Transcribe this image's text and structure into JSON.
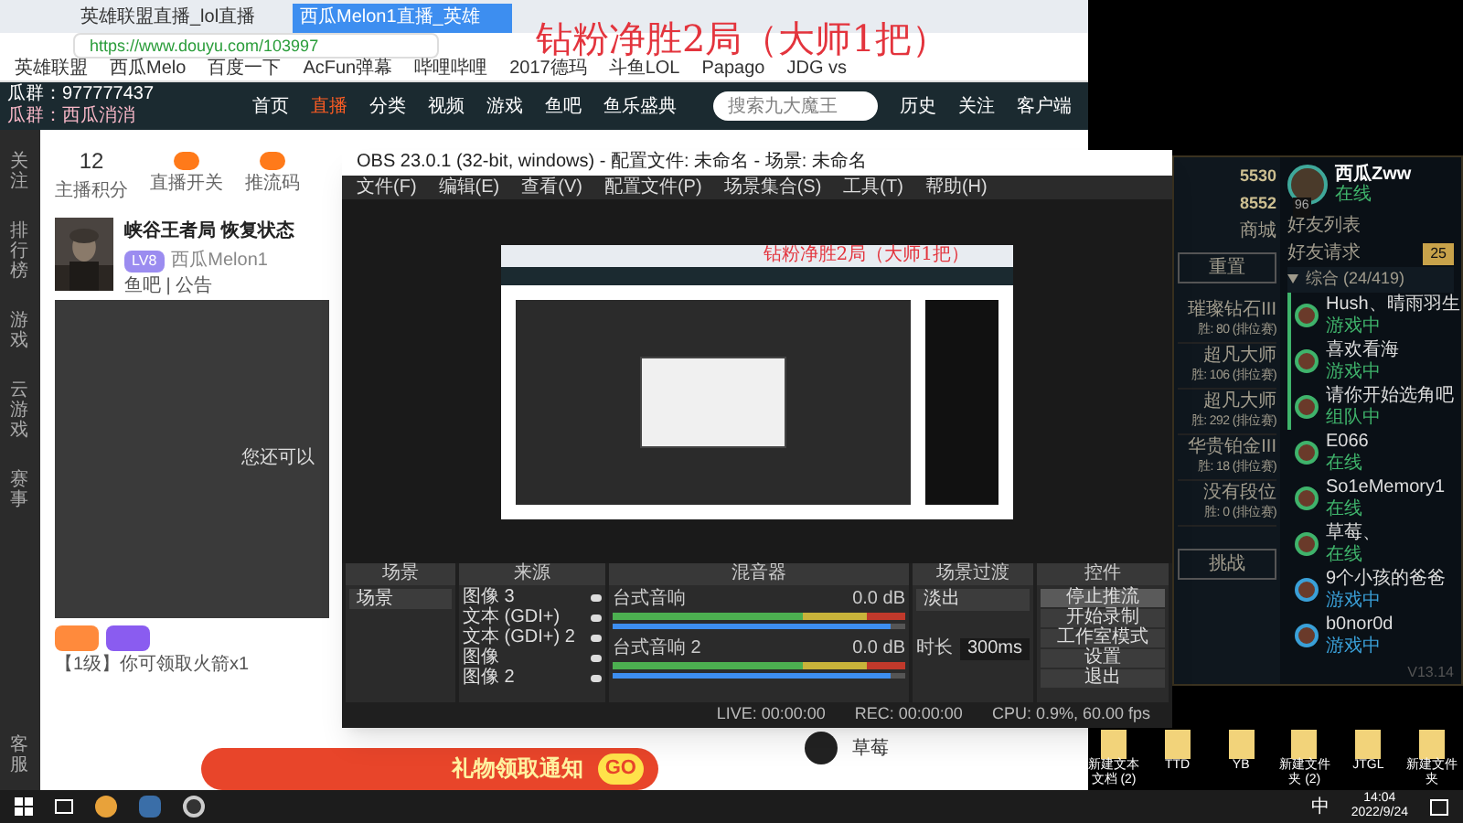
{
  "browser": {
    "tabs": [
      {
        "label": "英雄联盟直播_lol直播",
        "selected": false
      },
      {
        "label": "西瓜Melon1直播_英雄",
        "selected": true
      }
    ],
    "url": "https://www.douyu.com/103997",
    "bookmarks": [
      "英雄联盟",
      "西瓜Melo",
      "百度一下",
      "AcFun弹幕",
      "哔哩哔哩",
      "2017德玛",
      "斗鱼LOL",
      "Papago",
      "JDG vs"
    ],
    "overlay_title": "钻粉净胜2局（大师1把）",
    "overlay_lines": [
      "瓜群：977777437",
      "瓜群：西瓜消消"
    ],
    "nav": [
      {
        "label": "首页",
        "selected": false
      },
      {
        "label": "直播",
        "selected": true
      },
      {
        "label": "分类",
        "selected": false
      },
      {
        "label": "视频",
        "selected": false
      },
      {
        "label": "游戏",
        "selected": false
      },
      {
        "label": "鱼吧",
        "selected": false
      },
      {
        "label": "鱼乐盛典",
        "selected": false
      }
    ],
    "search": {
      "placeholder": "搜索九大魔王"
    },
    "header_actions": [
      "历史",
      "关注",
      "客户端"
    ],
    "sidebar": [
      "关注",
      "排行榜",
      "游戏",
      "云游戏",
      "赛事"
    ],
    "sidebar_bottom": "客服",
    "stats": [
      {
        "value": "12",
        "label": "主播积分"
      },
      {
        "label": "直播开关"
      },
      {
        "label": "推流码"
      }
    ],
    "room": {
      "title": "峡谷王者局 恢复状态",
      "streamer": "西瓜Melon1",
      "level": "LV8",
      "photo_caption": "鱼吧 | 公告"
    },
    "video_text": "您还可以",
    "chat_notice": "【1级】你可领取火箭x1",
    "banner": {
      "text": "礼物领取通知",
      "button": "GO"
    },
    "comment_user": "草莓"
  },
  "obs": {
    "title": "OBS 23.0.1 (32-bit, windows) - 配置文件: 未命名 - 场景: 未命名",
    "menu": [
      "文件(F)",
      "编辑(E)",
      "查看(V)",
      "配置文件(P)",
      "场景集合(S)",
      "工具(T)",
      "帮助(H)"
    ],
    "preview_title": "钻粉净胜2局（大师1把）",
    "docks": {
      "scenes": "场景",
      "sources": "来源",
      "mixer": "混音器",
      "transitions": "场景过渡",
      "controls": "控件"
    },
    "scenes": [
      {
        "name": "场景",
        "selected": true
      }
    ],
    "sources": [
      {
        "name": "图像 3",
        "visible": true
      },
      {
        "name": "文本 (GDI+)",
        "visible": true
      },
      {
        "name": "文本 (GDI+) 2",
        "visible": true
      },
      {
        "name": "图像",
        "visible": true
      },
      {
        "name": "图像 2",
        "visible": true
      }
    ],
    "channels": [
      {
        "name": "台式音响",
        "reading": "0.0 dB",
        "level": 0.95
      },
      {
        "name": "台式音响 2",
        "reading": "0.0 dB",
        "level": 0.95
      }
    ],
    "transition": {
      "value": "淡出",
      "duration_label": "时长",
      "duration": "300ms"
    },
    "controls": [
      {
        "label": "停止推流",
        "active": true
      },
      {
        "label": "开始录制",
        "active": false
      },
      {
        "label": "工作室模式",
        "active": false
      },
      {
        "label": "设置",
        "active": false
      },
      {
        "label": "退出",
        "active": false
      }
    ],
    "status": [
      "LIVE: 00:00:00",
      "REC: 00:00:00",
      "CPU: 0.9%, 60.00 fps"
    ]
  },
  "client": {
    "currency": [
      "5530",
      "8552"
    ],
    "shop": "商城",
    "user": "西瓜Zww",
    "user_status": "在线",
    "avatar_level": "96",
    "top_button": "重置",
    "ranks": [
      {
        "tier": "璀璨钻石III",
        "wins": "胜: 80 (排位赛)"
      },
      {
        "tier": "超凡大师",
        "wins": "胜: 106 (排位赛)"
      },
      {
        "tier": "超凡大师",
        "wins": "胜: 292 (排位赛)"
      },
      {
        "tier": "华贵铂金III",
        "wins": "胜: 18 (排位赛)"
      },
      {
        "tier": "没有段位",
        "wins": "胜: 0 (排位赛)"
      }
    ],
    "bottom_button": "挑战",
    "friends_title": "好友列表",
    "requests": {
      "label": "好友请求",
      "count": "25"
    },
    "group": {
      "label": "综合 (24/419)",
      "expanded": true
    },
    "friends": [
      {
        "name": "Hush、晴雨羽生",
        "status": "游戏中",
        "color": "#3fb36b",
        "in_game": true
      },
      {
        "name": "喜欢看海",
        "status": "游戏中",
        "color": "#3fb36b",
        "in_game": true
      },
      {
        "name": "请你开始选角吧",
        "status": "组队中",
        "color": "#3fb36b",
        "in_game": true
      },
      {
        "name": "E066",
        "status": "在线",
        "color": "#3fb36b",
        "in_game": false
      },
      {
        "name": "So1eMemory1",
        "status": "在线",
        "color": "#3fb36b",
        "in_game": false
      },
      {
        "name": "草莓、",
        "status": "在线",
        "color": "#3fb36b",
        "in_game": false
      },
      {
        "name": "9个小孩的爸爸",
        "status": "游戏中",
        "color": "#3aa0d8",
        "in_game": false
      },
      {
        "name": "b0nor0d",
        "status": "游戏中",
        "color": "#3aa0d8",
        "in_game": false
      }
    ],
    "version": "V13.14"
  },
  "desktop_icons": [
    "新建文本文档 (2)",
    "TTD",
    "YB",
    "新建文件夹 (2)",
    "JTGL",
    "新建文件夹"
  ],
  "taskbar": {
    "ime": "中",
    "time": "14:04",
    "date": "2022/9/24"
  }
}
